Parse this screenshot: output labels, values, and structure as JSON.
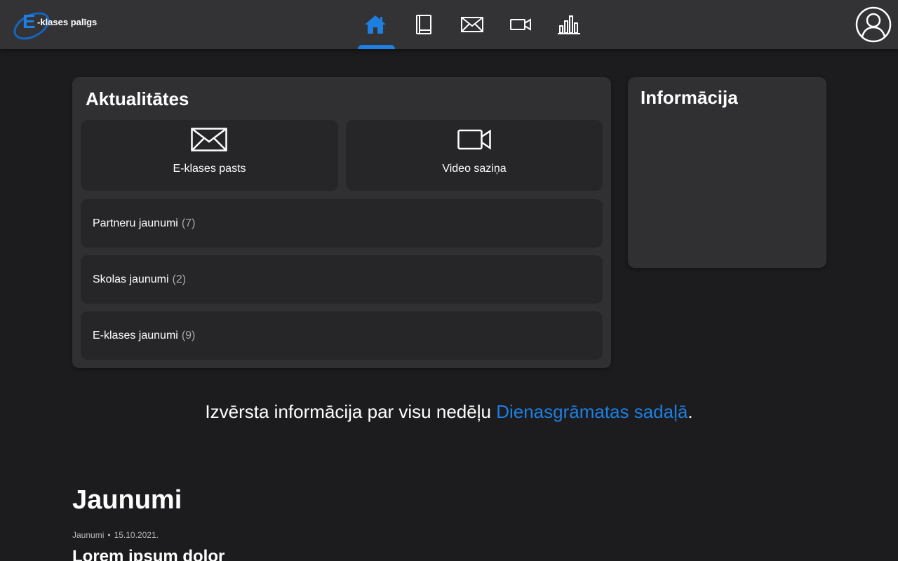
{
  "app": {
    "logo_letter": "E",
    "logo_text": "-klases palīgs",
    "accent_color": "#1e7fe0"
  },
  "nav": {
    "items": [
      {
        "icon": "home-icon",
        "active": true
      },
      {
        "icon": "book-icon",
        "active": false
      },
      {
        "icon": "mail-icon",
        "active": false
      },
      {
        "icon": "video-icon",
        "active": false
      },
      {
        "icon": "bar-chart-icon",
        "active": false
      }
    ],
    "profile_icon": "user-icon"
  },
  "updates": {
    "title": "Aktualitātes",
    "tiles": [
      {
        "icon": "mail-icon",
        "label": "E-klases pasts"
      },
      {
        "icon": "video-icon",
        "label": "Video saziņa"
      }
    ],
    "rows": [
      {
        "label": "Partneru jaunumi",
        "count": "(7)"
      },
      {
        "label": "Skolas jaunumi",
        "count": "(2)"
      },
      {
        "label": "E-klases jaunumi",
        "count": "(9)"
      }
    ]
  },
  "info": {
    "title": "Informācija"
  },
  "weekly": {
    "text": "Izvērsta informācija par visu nedēļu",
    "link": "Dienasgrāmatas sadaļā",
    "suffix": "."
  },
  "news": {
    "heading": "Jaunumi",
    "category": "Jaunumi",
    "separator": "•",
    "date": "15.10.2021.",
    "first_title": "Lorem ipsum dolor"
  }
}
